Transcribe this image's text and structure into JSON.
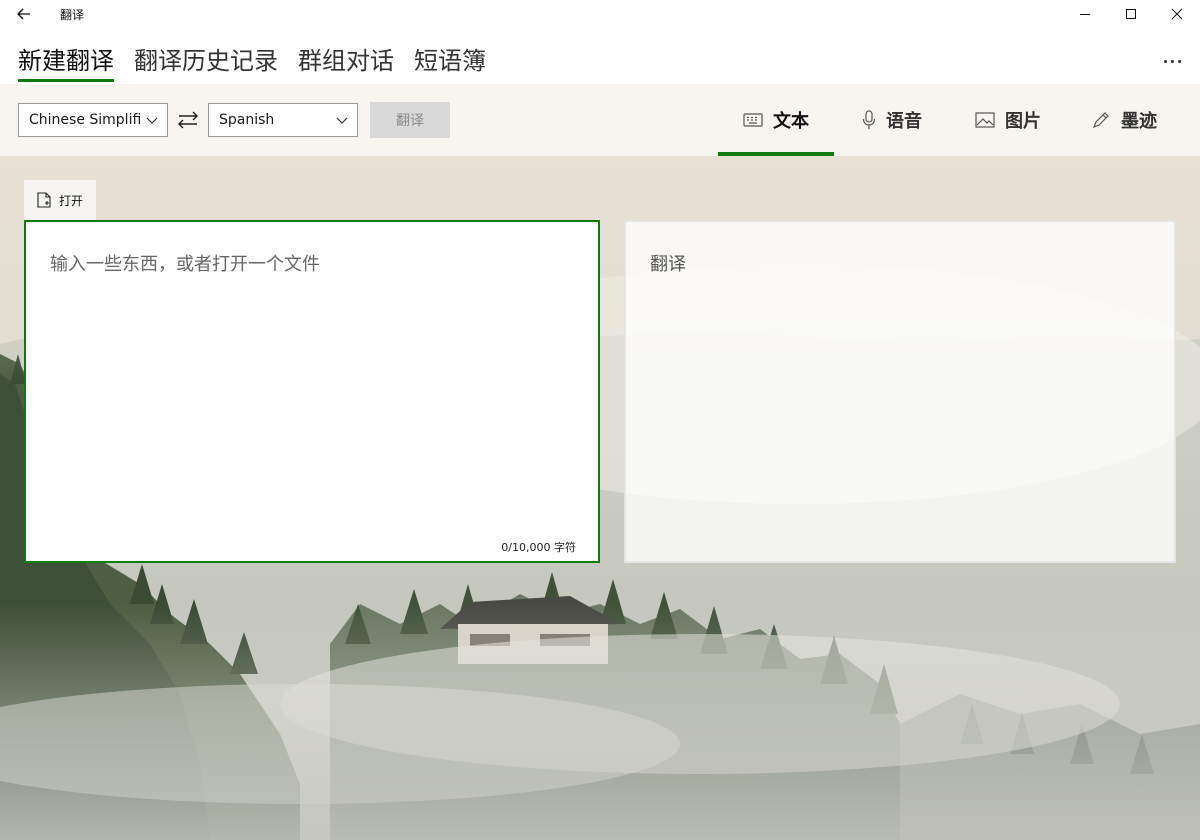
{
  "window": {
    "title": "翻译",
    "back_icon": "arrow-left-icon",
    "controls": [
      "minimize-icon",
      "maximize-icon",
      "close-icon"
    ]
  },
  "nav": {
    "items": [
      {
        "label": "新建翻译",
        "active": true
      },
      {
        "label": "翻译历史记录",
        "active": false
      },
      {
        "label": "群组对话",
        "active": false
      },
      {
        "label": "短语簿",
        "active": false
      }
    ],
    "more_icon": "more-ellipsis-icon",
    "accent_color": "#107c10"
  },
  "toolbar": {
    "source_language": "Chinese Simplifi",
    "target_language": "Spanish",
    "swap_icon": "swap-arrows-icon",
    "translate_label": "翻译",
    "modes": [
      {
        "label": "文本",
        "icon": "keyboard-icon",
        "active": true
      },
      {
        "label": "语音",
        "icon": "microphone-icon",
        "active": false
      },
      {
        "label": "图片",
        "icon": "image-icon",
        "active": false
      },
      {
        "label": "墨迹",
        "icon": "pen-icon",
        "active": false
      }
    ]
  },
  "input": {
    "open_label": "打开",
    "open_icon": "file-add-icon",
    "placeholder": "输入一些东西，或者打开一个文件",
    "char_count": "0/10,000 字符"
  },
  "output": {
    "placeholder": "翻译"
  }
}
